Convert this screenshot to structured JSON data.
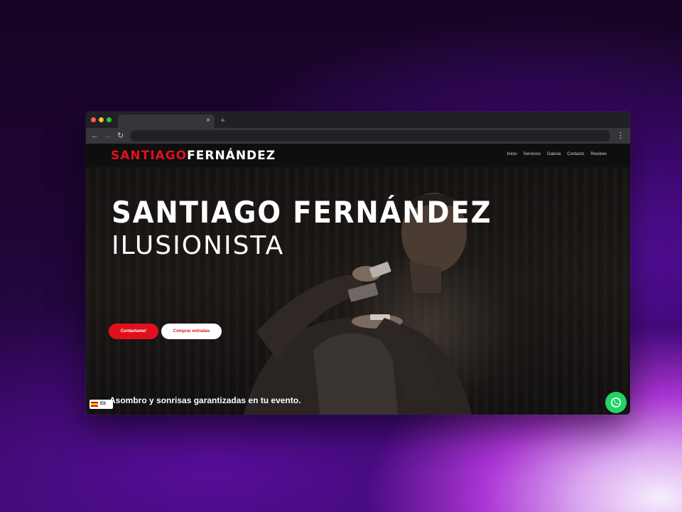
{
  "browser": {
    "tab_close": "×",
    "new_tab": "+",
    "back": "←",
    "forward": "→",
    "reload": "↻",
    "menu": "⋮"
  },
  "site": {
    "logo_first": "SANTIAGO",
    "logo_last": "FERNÁNDEZ",
    "nav": [
      "Inicio",
      "Servicios",
      "Galeria",
      "Contacto",
      "Reviews"
    ],
    "hero_title": "SANTIAGO FERNÁNDEZ",
    "hero_subtitle": "ILUSIONISTA",
    "cta_primary": "Contactame!",
    "cta_secondary": "Comprar entradas",
    "tagline": "Asombro y sonrisas garantizadas en tu evento.",
    "language": "ES",
    "colors": {
      "accent": "#e0101c",
      "whatsapp": "#25d366"
    }
  }
}
